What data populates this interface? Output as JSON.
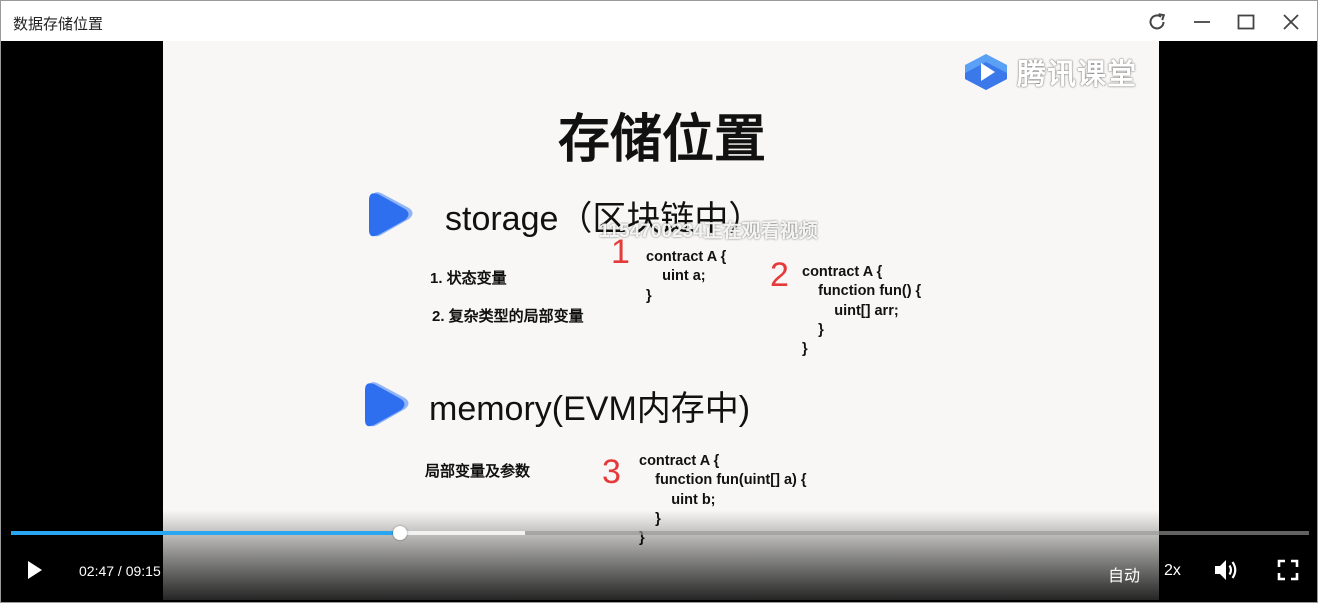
{
  "window": {
    "title": "数据存储位置",
    "buttons": [
      "refresh-icon",
      "minimize-icon",
      "maximize-icon",
      "close-icon"
    ]
  },
  "slide": {
    "brand": "腾讯课堂",
    "title": "存储位置",
    "section1": {
      "title": "storage（区块链中）",
      "bullets": [
        "1. 状态变量",
        "2. 复杂类型的局部变量"
      ]
    },
    "section2": {
      "title": "memory(EVM内存中)",
      "bullets": [
        "局部变量及参数"
      ]
    },
    "code1": {
      "number": "1",
      "text": "contract A {\n    uint a;\n}"
    },
    "code2": {
      "number": "2",
      "text": "contract A {\n    function fun() {\n        uint[] arr;\n    }\n}"
    },
    "code3": {
      "number": "3",
      "text": "contract A {\n    function fun(uint[] a) {\n        uint b;\n    }\n}"
    },
    "watermark": "1154700234正在观看视频"
  },
  "player": {
    "current_time": "02:47",
    "total_time": "09:15",
    "time_text": "02:47 / 09:15",
    "progress_played": 0.3,
    "progress_buffered": 0.396,
    "quality": "自动",
    "speed": "2x",
    "colors": {
      "played": "#2aa6f0",
      "accent_red": "#e53a3a",
      "logo_blue": "#2e6ff0"
    }
  }
}
